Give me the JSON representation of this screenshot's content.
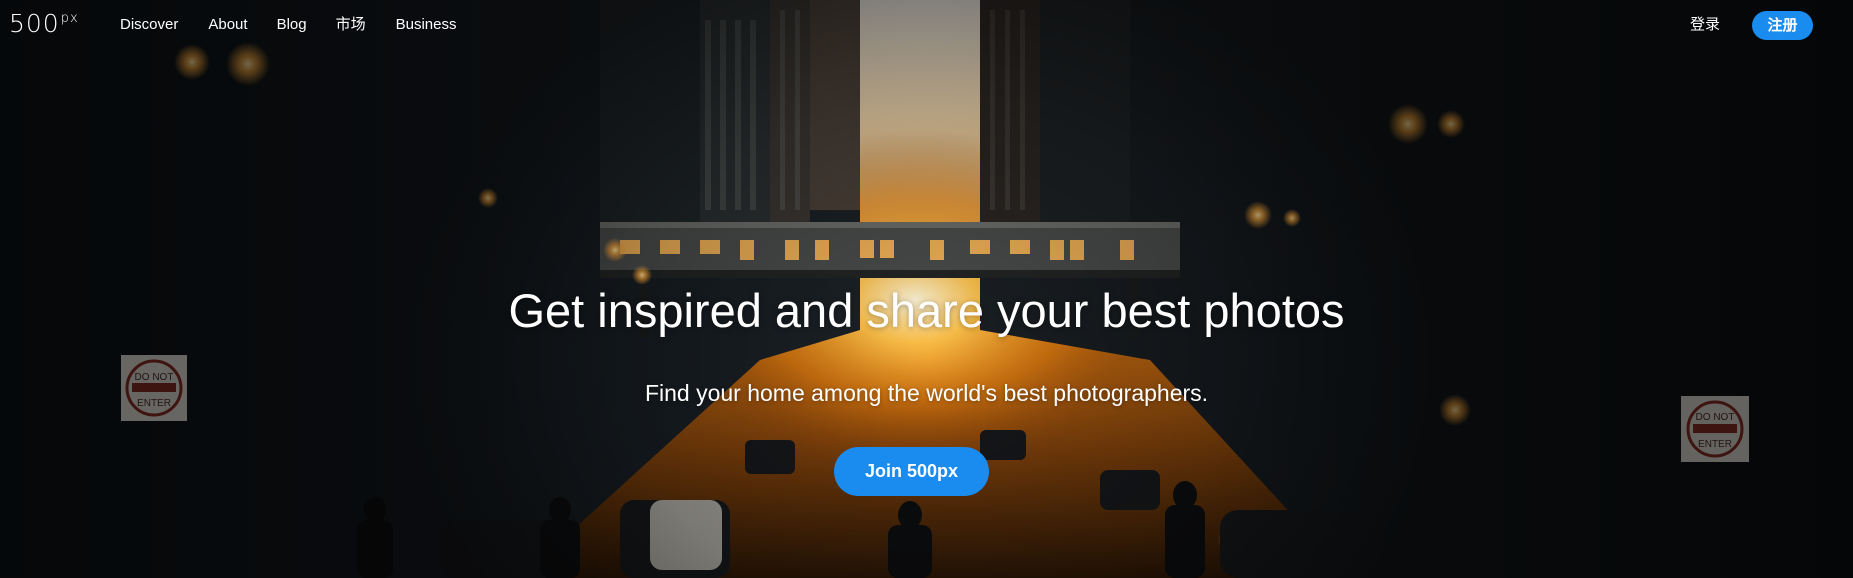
{
  "nav": {
    "logo": {
      "main": "500",
      "sup": "px"
    },
    "links": [
      {
        "label": "Discover"
      },
      {
        "label": "About"
      },
      {
        "label": "Blog"
      },
      {
        "label": "市场"
      },
      {
        "label": "Business"
      }
    ],
    "login_label": "登录",
    "signup_label": "注册"
  },
  "hero": {
    "headline": "Get inspired and share your best photos",
    "subline": "Find your home among the world's best photographers.",
    "cta_label": "Join 500px",
    "background_image": "city-street-sunset-photo",
    "sign_text_left": "DO NOT ENTER",
    "sign_text_right": "DO NOT ENTER"
  },
  "colors": {
    "accent": "#1a8cf0",
    "text": "#ffffff",
    "sunset": "#f7a21b"
  }
}
